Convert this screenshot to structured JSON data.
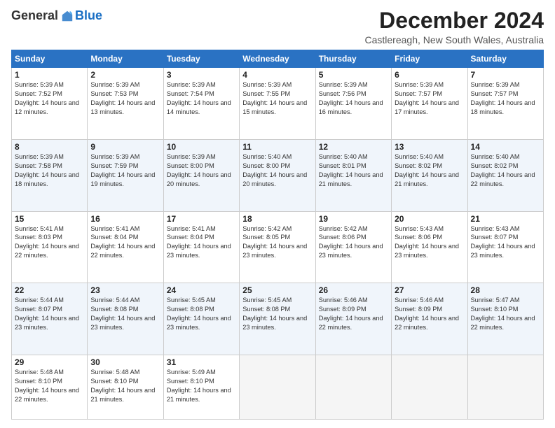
{
  "header": {
    "logo_general": "General",
    "logo_blue": "Blue",
    "month_title": "December 2024",
    "subtitle": "Castlereagh, New South Wales, Australia"
  },
  "weekdays": [
    "Sunday",
    "Monday",
    "Tuesday",
    "Wednesday",
    "Thursday",
    "Friday",
    "Saturday"
  ],
  "weeks": [
    [
      {
        "day": "1",
        "sunrise": "5:39 AM",
        "sunset": "7:52 PM",
        "daylight": "14 hours and 12 minutes."
      },
      {
        "day": "2",
        "sunrise": "5:39 AM",
        "sunset": "7:53 PM",
        "daylight": "14 hours and 13 minutes."
      },
      {
        "day": "3",
        "sunrise": "5:39 AM",
        "sunset": "7:54 PM",
        "daylight": "14 hours and 14 minutes."
      },
      {
        "day": "4",
        "sunrise": "5:39 AM",
        "sunset": "7:55 PM",
        "daylight": "14 hours and 15 minutes."
      },
      {
        "day": "5",
        "sunrise": "5:39 AM",
        "sunset": "7:56 PM",
        "daylight": "14 hours and 16 minutes."
      },
      {
        "day": "6",
        "sunrise": "5:39 AM",
        "sunset": "7:57 PM",
        "daylight": "14 hours and 17 minutes."
      },
      {
        "day": "7",
        "sunrise": "5:39 AM",
        "sunset": "7:57 PM",
        "daylight": "14 hours and 18 minutes."
      }
    ],
    [
      {
        "day": "8",
        "sunrise": "5:39 AM",
        "sunset": "7:58 PM",
        "daylight": "14 hours and 18 minutes."
      },
      {
        "day": "9",
        "sunrise": "5:39 AM",
        "sunset": "7:59 PM",
        "daylight": "14 hours and 19 minutes."
      },
      {
        "day": "10",
        "sunrise": "5:39 AM",
        "sunset": "8:00 PM",
        "daylight": "14 hours and 20 minutes."
      },
      {
        "day": "11",
        "sunrise": "5:40 AM",
        "sunset": "8:00 PM",
        "daylight": "14 hours and 20 minutes."
      },
      {
        "day": "12",
        "sunrise": "5:40 AM",
        "sunset": "8:01 PM",
        "daylight": "14 hours and 21 minutes."
      },
      {
        "day": "13",
        "sunrise": "5:40 AM",
        "sunset": "8:02 PM",
        "daylight": "14 hours and 21 minutes."
      },
      {
        "day": "14",
        "sunrise": "5:40 AM",
        "sunset": "8:02 PM",
        "daylight": "14 hours and 22 minutes."
      }
    ],
    [
      {
        "day": "15",
        "sunrise": "5:41 AM",
        "sunset": "8:03 PM",
        "daylight": "14 hours and 22 minutes."
      },
      {
        "day": "16",
        "sunrise": "5:41 AM",
        "sunset": "8:04 PM",
        "daylight": "14 hours and 22 minutes."
      },
      {
        "day": "17",
        "sunrise": "5:41 AM",
        "sunset": "8:04 PM",
        "daylight": "14 hours and 23 minutes."
      },
      {
        "day": "18",
        "sunrise": "5:42 AM",
        "sunset": "8:05 PM",
        "daylight": "14 hours and 23 minutes."
      },
      {
        "day": "19",
        "sunrise": "5:42 AM",
        "sunset": "8:06 PM",
        "daylight": "14 hours and 23 minutes."
      },
      {
        "day": "20",
        "sunrise": "5:43 AM",
        "sunset": "8:06 PM",
        "daylight": "14 hours and 23 minutes."
      },
      {
        "day": "21",
        "sunrise": "5:43 AM",
        "sunset": "8:07 PM",
        "daylight": "14 hours and 23 minutes."
      }
    ],
    [
      {
        "day": "22",
        "sunrise": "5:44 AM",
        "sunset": "8:07 PM",
        "daylight": "14 hours and 23 minutes."
      },
      {
        "day": "23",
        "sunrise": "5:44 AM",
        "sunset": "8:08 PM",
        "daylight": "14 hours and 23 minutes."
      },
      {
        "day": "24",
        "sunrise": "5:45 AM",
        "sunset": "8:08 PM",
        "daylight": "14 hours and 23 minutes."
      },
      {
        "day": "25",
        "sunrise": "5:45 AM",
        "sunset": "8:08 PM",
        "daylight": "14 hours and 23 minutes."
      },
      {
        "day": "26",
        "sunrise": "5:46 AM",
        "sunset": "8:09 PM",
        "daylight": "14 hours and 22 minutes."
      },
      {
        "day": "27",
        "sunrise": "5:46 AM",
        "sunset": "8:09 PM",
        "daylight": "14 hours and 22 minutes."
      },
      {
        "day": "28",
        "sunrise": "5:47 AM",
        "sunset": "8:10 PM",
        "daylight": "14 hours and 22 minutes."
      }
    ],
    [
      {
        "day": "29",
        "sunrise": "5:48 AM",
        "sunset": "8:10 PM",
        "daylight": "14 hours and 22 minutes."
      },
      {
        "day": "30",
        "sunrise": "5:48 AM",
        "sunset": "8:10 PM",
        "daylight": "14 hours and 21 minutes."
      },
      {
        "day": "31",
        "sunrise": "5:49 AM",
        "sunset": "8:10 PM",
        "daylight": "14 hours and 21 minutes."
      },
      null,
      null,
      null,
      null
    ]
  ]
}
